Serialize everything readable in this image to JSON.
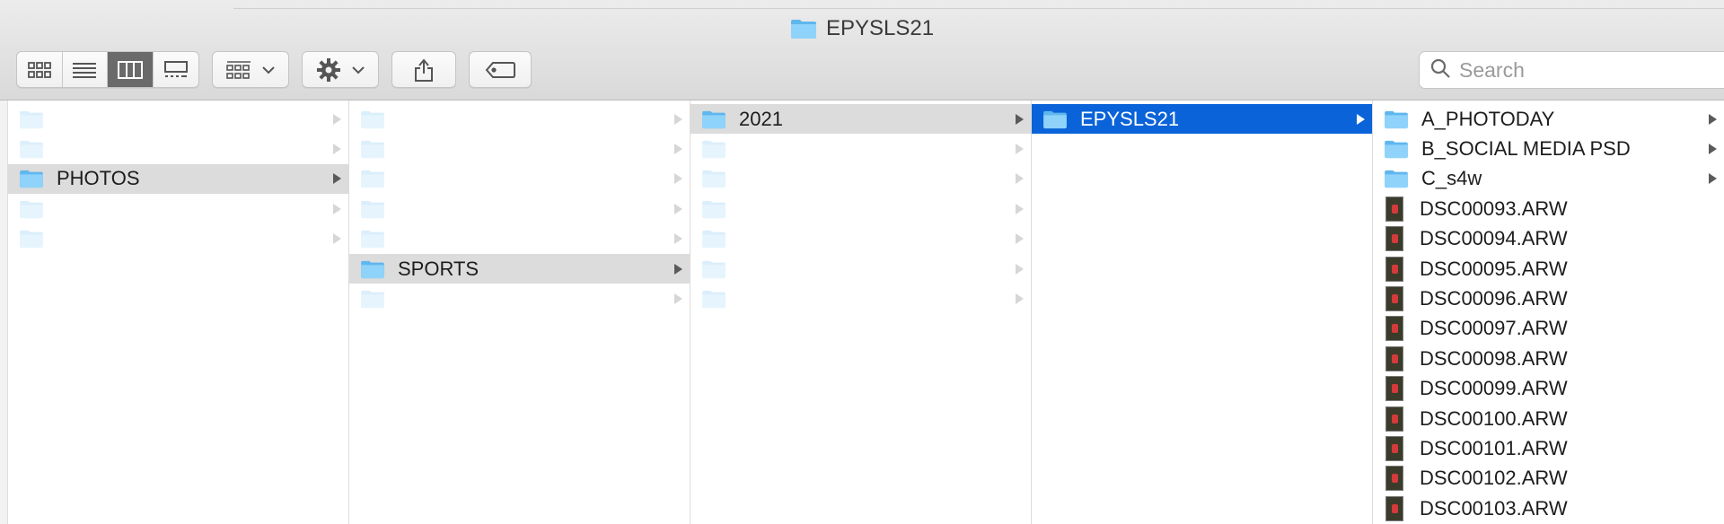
{
  "window": {
    "title": "EPYSLS21"
  },
  "toolbar": {
    "view_buttons": [
      {
        "icon": "icon-view-grid-icon",
        "active": false
      },
      {
        "icon": "list-view-icon",
        "active": false
      },
      {
        "icon": "column-view-icon",
        "active": true
      },
      {
        "icon": "gallery-view-icon",
        "active": false
      }
    ],
    "group_icon": "group-by-icon",
    "action_icon": "gear-icon",
    "share_icon": "share-icon",
    "tag_icon": "tag-icon"
  },
  "search": {
    "placeholder": "Search"
  },
  "columns": {
    "col1": {
      "selected": "PHOTOS"
    },
    "col2": {
      "selected": "SPORTS"
    },
    "col3": {
      "selected": "2021"
    },
    "col4": {
      "selected": "EPYSLS21"
    },
    "col5": {
      "folders": [
        "A_PHOTODAY",
        "B_SOCIAL MEDIA PSD",
        "C_s4w"
      ],
      "files": [
        "DSC00093.ARW",
        "DSC00094.ARW",
        "DSC00095.ARW",
        "DSC00096.ARW",
        "DSC00097.ARW",
        "DSC00098.ARW",
        "DSC00099.ARW",
        "DSC00100.ARW",
        "DSC00101.ARW",
        "DSC00102.ARW",
        "DSC00103.ARW"
      ]
    }
  },
  "colors": {
    "selection_blue": "#0a63d8",
    "selection_gray": "#dcdcdc",
    "folder_blue": "#6cc4f4"
  }
}
